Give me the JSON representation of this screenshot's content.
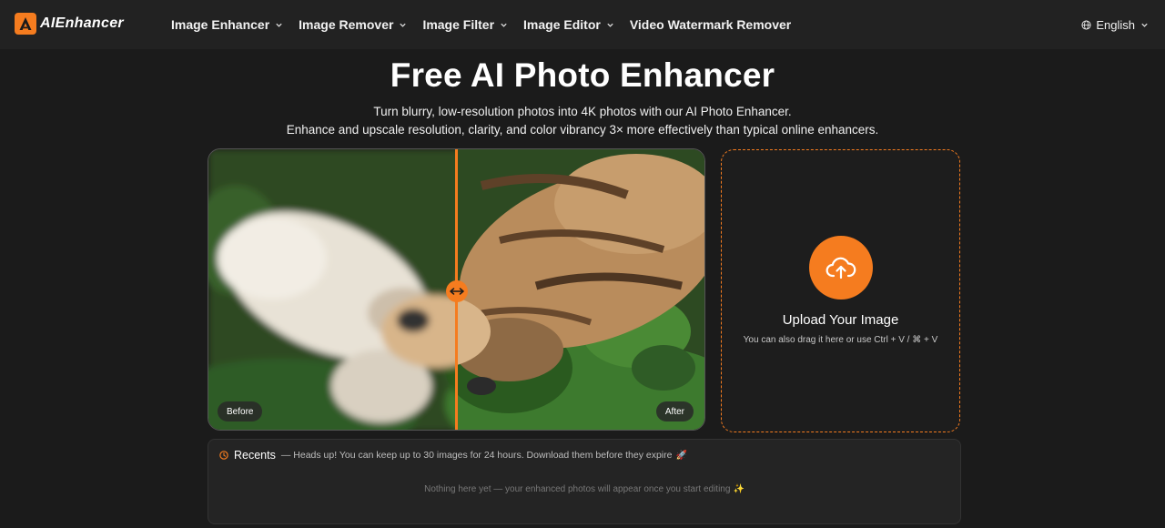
{
  "brand": {
    "name": "AIEnhancer",
    "accent": "#f57c1f"
  },
  "nav": {
    "items": [
      {
        "label": "Image Enhancer",
        "dropdown": true
      },
      {
        "label": "Image Remover",
        "dropdown": true
      },
      {
        "label": "Image Filter",
        "dropdown": true
      },
      {
        "label": "Image Editor",
        "dropdown": true
      },
      {
        "label": "Video Watermark Remover",
        "dropdown": false
      }
    ],
    "language": "English"
  },
  "hero": {
    "title": "Free AI Photo Enhancer",
    "subtitle_line1": "Turn blurry, low-resolution photos into 4K photos with our AI Photo Enhancer.",
    "subtitle_line2": "Enhance and upscale resolution, clarity, and color vibrancy 3× more effectively than typical online enhancers."
  },
  "comparison": {
    "before_label": "Before",
    "after_label": "After",
    "slider_position": 0.5
  },
  "upload": {
    "title": "Upload Your Image",
    "hint": "You can also drag it here or use Ctrl + V / ⌘ + V"
  },
  "recents": {
    "title": "Recents",
    "note": "— Heads up! You can keep up to 30 images for 24 hours. Download them before they expire",
    "note_emoji": "🚀",
    "empty_message": "Nothing here yet — your enhanced photos will appear once you start editing",
    "empty_emoji": "✨"
  },
  "icons": {
    "logo": "logo-a-icon",
    "dropdown": "chevron-down-icon",
    "language": "globe-icon",
    "slider": "horizontal-arrows-icon",
    "upload": "cloud-upload-icon",
    "recents": "clock-icon"
  }
}
